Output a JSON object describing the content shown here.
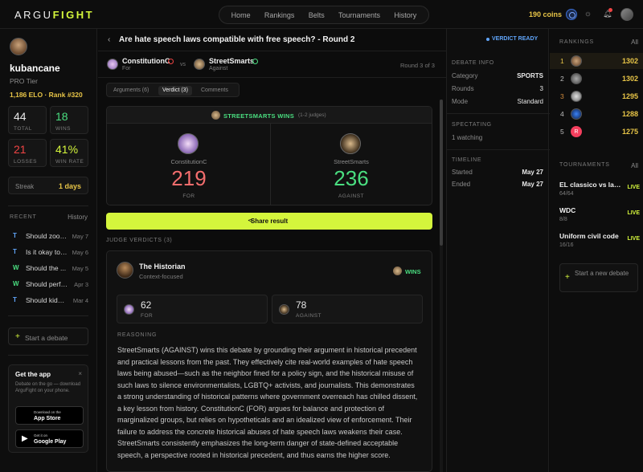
{
  "brand": {
    "prefix": "ARGU",
    "suffix": "FIGHT"
  },
  "nav": {
    "items": [
      "Home",
      "Rankings",
      "Belts",
      "Tournaments",
      "History"
    ]
  },
  "header": {
    "coins": "190 coins"
  },
  "profile": {
    "username": "kubancane",
    "tier": "PRO Tier",
    "elo": "1,186 ELO",
    "rank": "Rank #320",
    "stats": [
      {
        "value": "44",
        "label": "TOTAL",
        "color": "#e8e8e8"
      },
      {
        "value": "18",
        "label": "WINS",
        "color": "#4ade80"
      },
      {
        "value": "21",
        "label": "LOSSES",
        "color": "#ef4444"
      },
      {
        "value": "41%",
        "label": "WIN RATE",
        "color": "#d4f53c"
      }
    ],
    "streak_label": "Streak",
    "streak_value": "1 days"
  },
  "recent": {
    "heading": "RECENT",
    "history_link": "History",
    "items": [
      {
        "badge": "T",
        "badge_color": "#60a5fa",
        "title": "Should zoos...",
        "date": "May 7"
      },
      {
        "badge": "T",
        "badge_color": "#60a5fa",
        "title": "Is it okay to l...",
        "date": "May 6"
      },
      {
        "badge": "W",
        "badge_color": "#4ade80",
        "title": "Should the ...",
        "date": "May 5"
      },
      {
        "badge": "W",
        "badge_color": "#4ade80",
        "title": "Should perfo...",
        "date": "Apr 3"
      },
      {
        "badge": "T",
        "badge_color": "#60a5fa",
        "title": "Should kids l...",
        "date": "Mar 4"
      }
    ]
  },
  "left_start": "Start a debate",
  "get_app": {
    "title": "Get the app",
    "close": "×",
    "desc": "Debate on the go — download ArguFight on your phone.",
    "app_store_small": "Download on the",
    "app_store_big": "App Store",
    "play_small": "Get it on",
    "play_big": "Google Play"
  },
  "debate": {
    "back": "‹",
    "title": "Are hate speech laws compatible with free speech? - Round 2",
    "status": "VERDICT READY",
    "p1": {
      "name": "ConstitutionC",
      "side": "For"
    },
    "p2": {
      "name": "StreetSmarts",
      "side": "Against"
    },
    "vs": "vs",
    "round": "Round 3 of 3",
    "tabs": [
      "Arguments (6)",
      "Verdict (3)",
      "Comments"
    ]
  },
  "verdict": {
    "winner_text": "STREETSMARTS WINS",
    "judges_note": "(1-2 judges)",
    "for": {
      "name": "ConstitutionC",
      "score": "219",
      "label": "FOR",
      "color": "#f26d6d"
    },
    "against": {
      "name": "StreetSmarts",
      "score": "236",
      "label": "AGAINST",
      "color": "#4ade80"
    },
    "share_label": "Share result"
  },
  "judge": {
    "section_heading": "JUDGE VERDICTS (3)",
    "name": "The Historian",
    "focus": "Context-focused",
    "wins_label": "WINS",
    "for_score": "62",
    "for_label": "FOR",
    "against_score": "78",
    "against_label": "AGAINST",
    "reasoning_heading": "REASONING",
    "reasoning": "StreetSmarts (AGAINST) wins this debate by grounding their argument in historical precedent and practical lessons from the past. They effectively cite real-world examples of hate speech laws being abused—such as the neighbor fined for a policy sign, and the historical misuse of such laws to silence environmentalists, LGBTQ+ activists, and journalists. This demonstrates a strong understanding of historical patterns where government overreach has chilled dissent, a key lesson from history. ConstitutionC (FOR) argues for balance and protection of marginalized groups, but relies on hypotheticals and an idealized view of enforcement. Their failure to address the concrete historical abuses of hate speech laws weakens their case. StreetSmarts consistently emphasizes the long-term danger of state-defined acceptable speech, a perspective rooted in historical precedent, and thus earns the higher score."
  },
  "info": {
    "heading": "DEBATE INFO",
    "rows": [
      {
        "k": "Category",
        "v": "SPORTS"
      },
      {
        "k": "Rounds",
        "v": "3"
      },
      {
        "k": "Mode",
        "v": "Standard"
      }
    ],
    "spectating_heading": "SPECTATING",
    "watching": "1 watching",
    "timeline_heading": "TIMELINE",
    "timeline": [
      {
        "k": "Started",
        "v": "May 27"
      },
      {
        "k": "Ended",
        "v": "May 27"
      }
    ]
  },
  "rankings": {
    "heading": "RANKINGS",
    "all": "All",
    "rows": [
      {
        "pos": "1",
        "score": "1302",
        "pos_color": "#e8c547"
      },
      {
        "pos": "2",
        "score": "1302",
        "pos_color": "#bdbdbd"
      },
      {
        "pos": "3",
        "score": "1295",
        "pos_color": "#d08a3c"
      },
      {
        "pos": "4",
        "score": "1288",
        "pos_color": "#bdbdbd"
      },
      {
        "pos": "5",
        "score": "1275",
        "pos_color": "#bdbdbd",
        "avatar_letter": "R"
      }
    ]
  },
  "tournaments": {
    "heading": "TOURNAMENTS",
    "all": "All",
    "items": [
      {
        "title": "EL classico vs la li...",
        "count": "64/64",
        "live": "LIVE"
      },
      {
        "title": "WDC",
        "count": "8/8",
        "live": "LIVE"
      },
      {
        "title": "Uniform civil code",
        "count": "16/16",
        "live": "LIVE"
      }
    ],
    "start_label": "Start a new debate"
  }
}
